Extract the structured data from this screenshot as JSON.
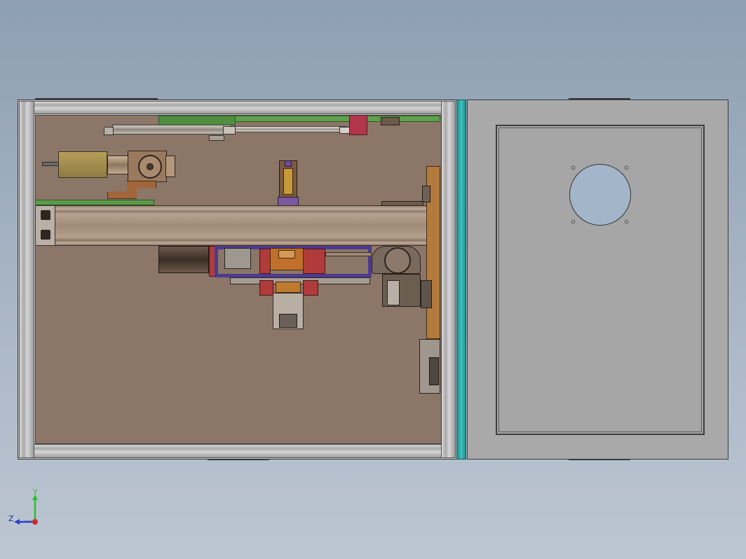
{
  "viewport": {
    "background_top": "#8d9fb3",
    "background_bottom": "#bcc6d2"
  },
  "model": {
    "interior_color": "#8b7668",
    "frame_color": "#c9c9c9",
    "panel_color": "#a9a9a9",
    "hinge_strip_color": "#3fc1c1",
    "linear_rail_color": "#5fa14c",
    "carriage_color": "#4c3a8f",
    "block_color": "#b03b3b",
    "column_color": "#b37a3b",
    "fan_cutout_color": "#a3b5c9"
  },
  "triad": {
    "y_label": "Y",
    "z_label": "Z",
    "y_color": "#2dbf2d",
    "z_color": "#2b3fcf",
    "x_color": "#d12a2a"
  }
}
